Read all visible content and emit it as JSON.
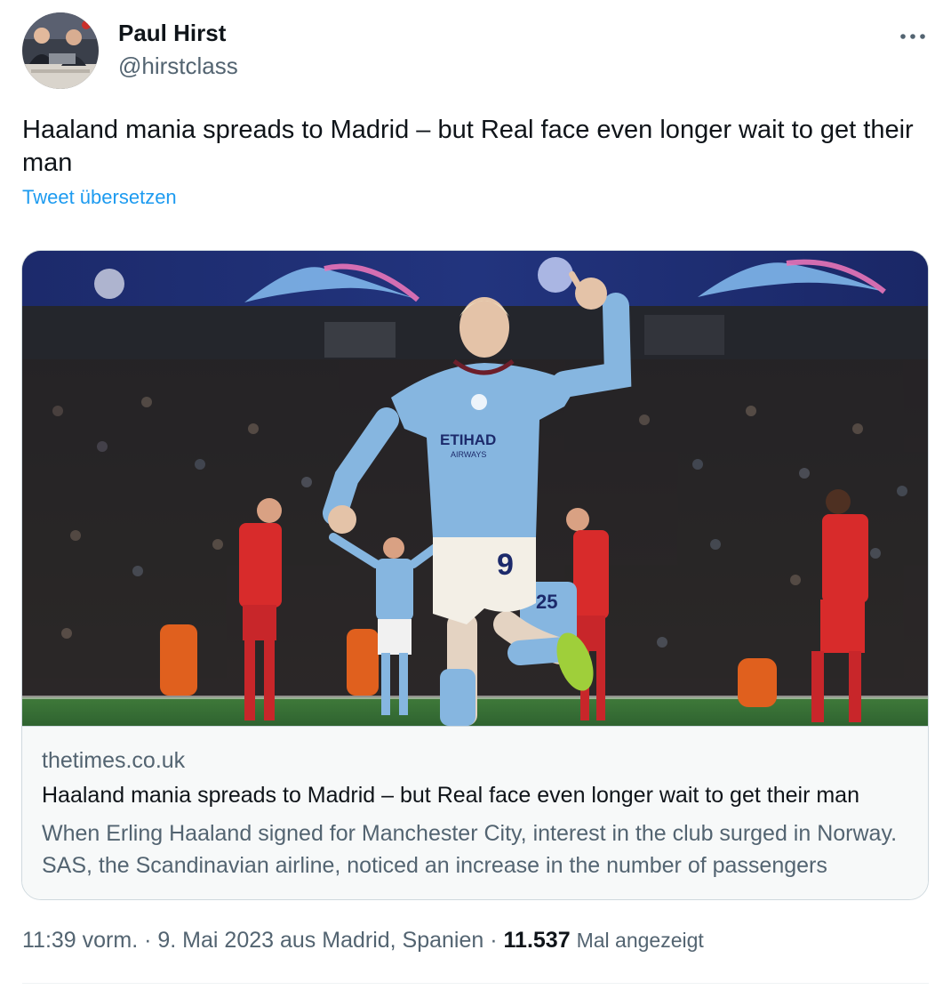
{
  "author": {
    "name": "Paul Hirst",
    "handle": "@hirstclass"
  },
  "more_icon": "more-horizontal-icon",
  "tweet": {
    "text": "Haaland mania spreads to Madrid – but Real face even longer wait to get their man",
    "translate_label": "Tweet übersetzen"
  },
  "card": {
    "domain": "thetimes.co.uk",
    "title": "Haaland mania spreads to Madrid – but Real face even longer wait to get their man",
    "description": "When Erling Haaland signed for Manchester City, interest in the club surged in Norway. SAS, the Scandinavian airline, noticed an increase in the number of passengers",
    "image": {
      "shirt_sponsor": "ETIHAD",
      "shirt_sponsor_sub": "AIRWAYS",
      "shirt_number": "9",
      "teammate_number": "25"
    }
  },
  "meta": {
    "time": "11:39 vorm.",
    "separator": "·",
    "date": "9. Mai 2023",
    "location": "aus Madrid, Spanien",
    "views_count": "11.537",
    "views_label": "Mal angezeigt"
  },
  "colors": {
    "text_primary": "#0f1419",
    "text_secondary": "#536471",
    "link_blue": "#1d9bf0",
    "border": "#cfd9de",
    "card_footer_bg": "#f7f9f9"
  }
}
